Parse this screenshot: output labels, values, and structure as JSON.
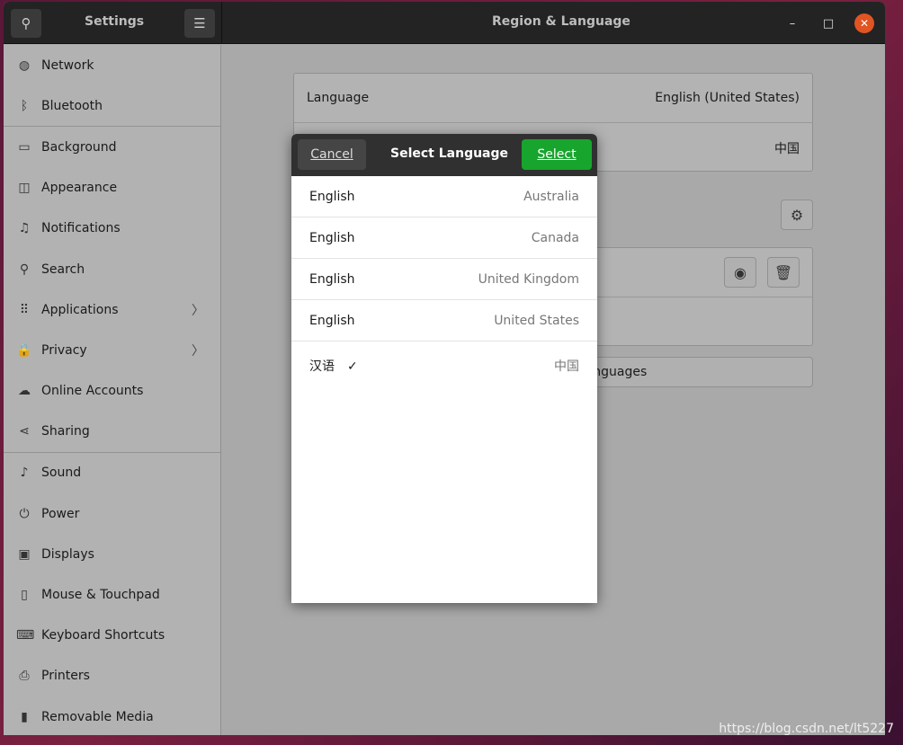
{
  "header": {
    "app_title": "Settings",
    "panel_title": "Region & Language"
  },
  "sidebar": {
    "items": [
      {
        "label": "Network",
        "icon": "globe-icon",
        "glyph": "◍"
      },
      {
        "label": "Bluetooth",
        "icon": "bluetooth-icon",
        "glyph": "ᛒ"
      },
      {
        "label": "Background",
        "icon": "monitor-icon",
        "glyph": "▭"
      },
      {
        "label": "Appearance",
        "icon": "appearance-icon",
        "glyph": "◫"
      },
      {
        "label": "Notifications",
        "icon": "bell-icon",
        "glyph": "♫"
      },
      {
        "label": "Search",
        "icon": "search-icon",
        "glyph": "⚲"
      },
      {
        "label": "Applications",
        "icon": "grid-icon",
        "glyph": "⠿",
        "chevron": true
      },
      {
        "label": "Privacy",
        "icon": "lock-icon",
        "glyph": "🔒",
        "chevron": true
      },
      {
        "label": "Online Accounts",
        "icon": "cloud-icon",
        "glyph": "☁"
      },
      {
        "label": "Sharing",
        "icon": "share-icon",
        "glyph": "⋖"
      },
      {
        "label": "Sound",
        "icon": "music-icon",
        "glyph": "♪"
      },
      {
        "label": "Power",
        "icon": "power-icon",
        "glyph": "⏻"
      },
      {
        "label": "Displays",
        "icon": "display-icon",
        "glyph": "▣"
      },
      {
        "label": "Mouse & Touchpad",
        "icon": "mouse-icon",
        "glyph": "▯"
      },
      {
        "label": "Keyboard Shortcuts",
        "icon": "keyboard-icon",
        "glyph": "⌨"
      },
      {
        "label": "Printers",
        "icon": "printer-icon",
        "glyph": "⎙"
      },
      {
        "label": "Removable Media",
        "icon": "media-icon",
        "glyph": "▮"
      }
    ]
  },
  "main": {
    "language_label": "Language",
    "language_value": "English (United States)",
    "formats_value": "中国",
    "manage_label": "Manage Installed Languages"
  },
  "dialog": {
    "title": "Select Language",
    "cancel": "Cancel",
    "select": "Select",
    "select_color": "#17a52d",
    "rows": [
      {
        "language": "English",
        "country": "Australia"
      },
      {
        "language": "English",
        "country": "Canada"
      },
      {
        "language": "English",
        "country": "United Kingdom"
      },
      {
        "language": "English",
        "country": "United States"
      },
      {
        "language": "汉语",
        "country": "中国",
        "checked": true
      }
    ]
  },
  "watermark": "https://blog.csdn.net/lt5227"
}
